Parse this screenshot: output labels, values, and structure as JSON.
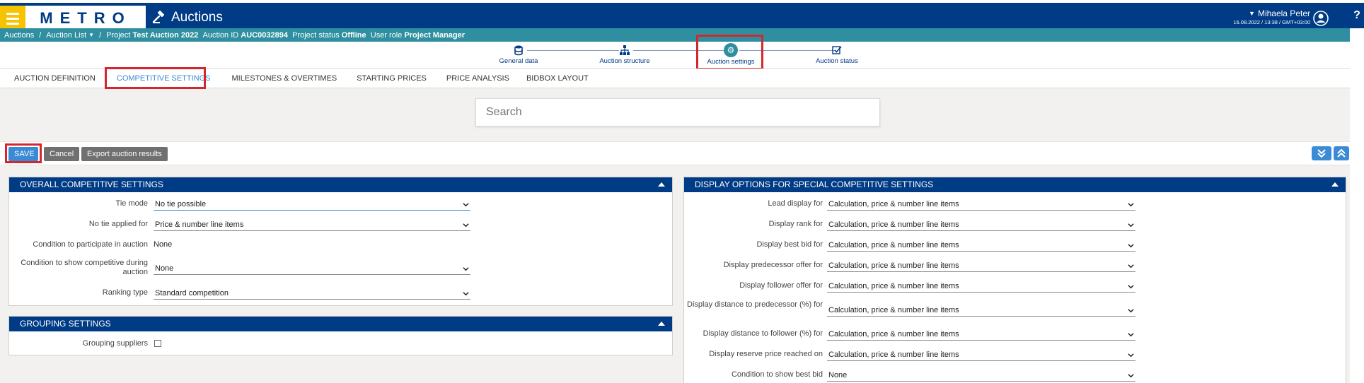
{
  "app": {
    "logo": "METRO",
    "title": "Auctions",
    "help": "?"
  },
  "user": {
    "name": "Mihaela Peter",
    "meta": "16.08.2022 / 13:38 / GMT+03:00"
  },
  "breadcrumb": {
    "auctions": "Auctions",
    "auction_list": "Auction List",
    "project_label": "Project",
    "project_value": "Test Auction 2022",
    "auction_id_label": "Auction ID",
    "auction_id_value": "AUC0032894",
    "status_label": "Project status",
    "status_value": "Offline",
    "role_label": "User role",
    "role_value": "Project Manager"
  },
  "stepper": {
    "steps": [
      {
        "label": "General data",
        "icon": "database-icon"
      },
      {
        "label": "Auction structure",
        "icon": "hierarchy-icon"
      },
      {
        "label": "Auction settings",
        "icon": "gear-icon"
      },
      {
        "label": "Auction status",
        "icon": "checkbox-edit-icon"
      }
    ],
    "active": 2
  },
  "tabs": [
    {
      "label": "AUCTION DEFINITION"
    },
    {
      "label": "COMPETITIVE SETTINGS"
    },
    {
      "label": "MILESTONES & OVERTIMES"
    },
    {
      "label": "STARTING PRICES"
    },
    {
      "label": "PRICE ANALYSIS"
    },
    {
      "label": "BIDBOX LAYOUT"
    }
  ],
  "active_tab": 1,
  "search": {
    "placeholder": "Search"
  },
  "actions": {
    "save": "SAVE",
    "cancel": "Cancel",
    "export": "Export auction results"
  },
  "overall": {
    "title": "OVERALL COMPETITIVE SETTINGS",
    "rows": [
      {
        "label": "Tie mode",
        "value": "No tie possible",
        "type": "select"
      },
      {
        "label": "No tie applied for",
        "value": "Price & number line items",
        "type": "select"
      },
      {
        "label": "Condition to participate in auction",
        "value": "None",
        "type": "text"
      },
      {
        "label": "Condition to show competitive during auction",
        "value": "None",
        "type": "select"
      },
      {
        "label": "Ranking type",
        "value": "Standard competition",
        "type": "select"
      }
    ]
  },
  "grouping": {
    "title": "GROUPING SETTINGS",
    "label": "Grouping suppliers",
    "checked": false
  },
  "display": {
    "title": "DISPLAY OPTIONS FOR SPECIAL COMPETITIVE SETTINGS",
    "rows": [
      {
        "label": "Lead display for",
        "value": "Calculation, price & number line items"
      },
      {
        "label": "Display rank for",
        "value": "Calculation, price & number line items"
      },
      {
        "label": "Display best bid for",
        "value": "Calculation, price & number line items"
      },
      {
        "label": "Display predecessor offer for",
        "value": "Calculation, price & number line items"
      },
      {
        "label": "Display follower offer for",
        "value": "Calculation, price & number line items"
      },
      {
        "label": "Display distance to predecessor (%) for",
        "value": "Calculation, price & number line items"
      },
      {
        "label": "Display distance to follower (%) for",
        "value": "Calculation, price & number line items"
      },
      {
        "label": "Display reserve price reached on",
        "value": "Calculation, price & number line items"
      },
      {
        "label": "Condition to show best bid",
        "value": "None"
      }
    ]
  },
  "colors": {
    "header": "#003b85",
    "breadcrumb": "#2f8fa1",
    "accent": "#3a8ad6",
    "menu": "#f7c200",
    "highlight": "#d4262c"
  }
}
